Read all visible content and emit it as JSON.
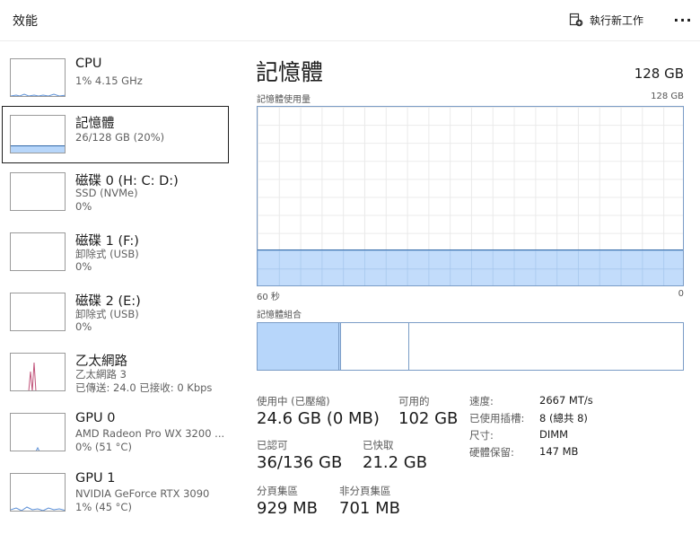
{
  "header": {
    "title": "效能",
    "run_task_label": "執行新工作",
    "more_label": "···"
  },
  "sidebar": {
    "items": [
      {
        "name": "CPU",
        "sub1": "1% 4.15 GHz",
        "sub2": ""
      },
      {
        "name": "記憶體",
        "sub1": "26/128 GB (20%)",
        "sub2": ""
      },
      {
        "name": "磁碟 0 (H: C: D:)",
        "sub1": "SSD (NVMe)",
        "sub2": "0%"
      },
      {
        "name": "磁碟 1 (F:)",
        "sub1": "卸除式 (USB)",
        "sub2": "0%"
      },
      {
        "name": "磁碟 2 (E:)",
        "sub1": "卸除式 (USB)",
        "sub2": "0%"
      },
      {
        "name": "乙太網路",
        "sub1": "乙太網路 3",
        "sub2": "已傳送: 24.0 已接收: 0 Kbps"
      },
      {
        "name": "GPU 0",
        "sub1": "AMD Radeon Pro WX 3200 ...",
        "sub2": "0% (51 °C)"
      },
      {
        "name": "GPU 1",
        "sub1": "NVIDIA GeForce RTX 3090",
        "sub2": "1% (45 °C)"
      }
    ],
    "selected_index": 1
  },
  "main": {
    "title": "記憶體",
    "total": "128 GB",
    "usage_chart": {
      "label": "記憶體使用量",
      "max_label": "128 GB",
      "x_left_label": "60 秒",
      "x_right_label": "0",
      "fill_fraction": 0.2
    },
    "composition": {
      "label": "記憶體組合",
      "segments": [
        {
          "name": "in-use",
          "fraction": 0.192,
          "color": "#b7d6fa"
        },
        {
          "name": "modified",
          "fraction": 0.005,
          "color": "#b7d6fa"
        },
        {
          "name": "standby",
          "fraction": 0.16,
          "color": "#ffffff"
        },
        {
          "name": "free",
          "fraction": 0.643,
          "color": "#ffffff"
        }
      ]
    },
    "stats": {
      "in_use_label": "使用中 (已壓縮)",
      "in_use_value": "24.6 GB (0 MB)",
      "available_label": "可用的",
      "available_value": "102 GB",
      "committed_label": "已認可",
      "committed_value": "36/136 GB",
      "cached_label": "已快取",
      "cached_value": "21.2 GB",
      "paged_label": "分頁集區",
      "paged_value": "929 MB",
      "nonpaged_label": "非分頁集區",
      "nonpaged_value": "701 MB"
    },
    "specs": [
      {
        "key": "速度:",
        "value": "2667 MT/s"
      },
      {
        "key": "已使用插槽:",
        "value": "8 (總共 8)"
      },
      {
        "key": "尺寸:",
        "value": "DIMM"
      },
      {
        "key": "硬體保留:",
        "value": "147 MB"
      }
    ]
  },
  "colors": {
    "accent": "#2f67a8",
    "memory_fill": "#b7d6fa",
    "ethernet_line": "#c1537a",
    "thumb_cpu": "#5b8fd6"
  }
}
